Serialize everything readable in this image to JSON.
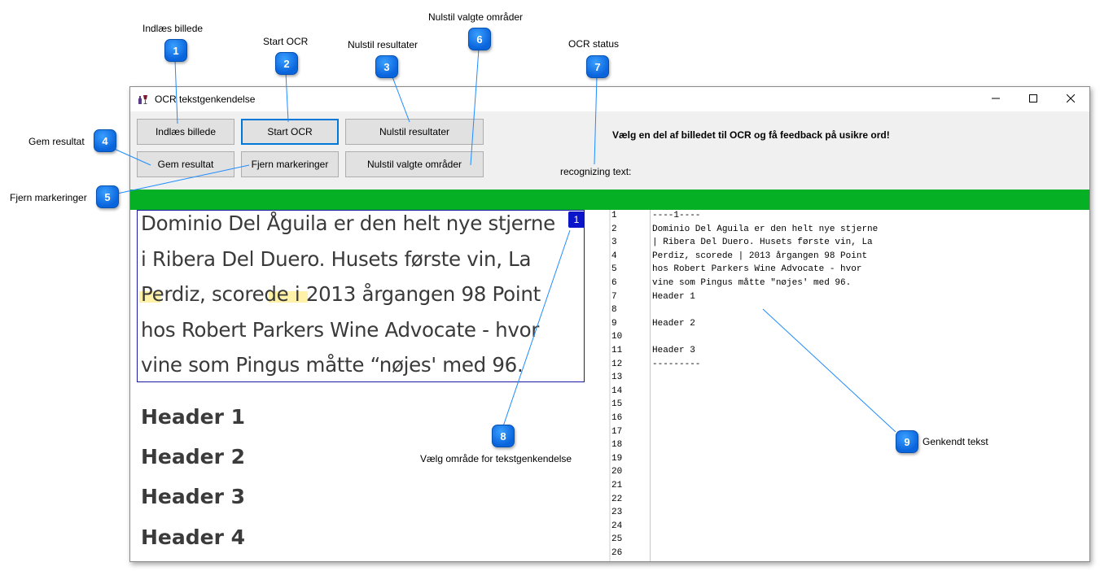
{
  "window": {
    "title": "OCR tekstgenkendelse"
  },
  "toolbar": {
    "load_image": "Indlæs billede",
    "start_ocr": "Start OCR",
    "reset_results": "Nulstil resultater",
    "save_result": "Gem resultat",
    "remove_marks": "Fjern markeringer",
    "reset_selected": "Nulstil valgte områder",
    "heading": "Vælg en del af billedet til OCR og få feedback på usikre ord!",
    "status": "recognizing text:"
  },
  "progress": {
    "value": 1.0,
    "color": "#06b025"
  },
  "image_pane": {
    "selection_tag": "1",
    "paragraph": [
      "Dominio Del Åguila er den helt nye stjerne",
      "i Ribera Del Duero. Husets første vin, La",
      "Perdiz, scorede i 2013 årgangen 98 Point",
      "hos Robert Parkers Wine Advocate - hvor",
      "vine som Pingus måtte “nøjes' med  96."
    ],
    "headers": [
      "Header 1",
      "Header 2",
      "Header 3",
      "Header 4"
    ]
  },
  "text_pane": {
    "line_numbers": [
      "1",
      "2",
      "3",
      "4",
      "5",
      "6",
      "7",
      "8",
      "9",
      "10",
      "11",
      "12",
      "13",
      "14",
      "15",
      "16",
      "17",
      "18",
      "19",
      "20",
      "21",
      "22",
      "23",
      "24",
      "25",
      "26"
    ],
    "lines": [
      "----1----",
      "Dominio Del Aguila er den helt nye stjerne",
      "| Ribera Del Duero. Husets første vin, La",
      "Perdiz, scorede | 2013 årgangen 98 Point",
      "hos Robert Parkers Wine Advocate - hvor",
      "vine som Pingus måtte \"nøjes' med 96.",
      "Header 1",
      "",
      "Header 2",
      "",
      "Header 3",
      "---------"
    ]
  },
  "callouts": [
    {
      "num": "1",
      "label": "Indlæs billede"
    },
    {
      "num": "2",
      "label": "Start OCR"
    },
    {
      "num": "3",
      "label": "Nulstil resultater"
    },
    {
      "num": "4",
      "label": "Gem resultat"
    },
    {
      "num": "5",
      "label": "Fjern markeringer"
    },
    {
      "num": "6",
      "label": "Nulstil valgte områder"
    },
    {
      "num": "7",
      "label": "OCR status"
    },
    {
      "num": "8",
      "label": "Vælg område for tekstgenkendelse"
    },
    {
      "num": "9",
      "label": "Genkendt tekst"
    }
  ],
  "colors": {
    "progress_green": "#06b025",
    "badge_blue": "#0a64dc",
    "selection_blue": "#1a1aa8",
    "leader_line": "#1e8cff",
    "highlight_yellow": "#ffe13c",
    "focus_blue": "#0078d7"
  },
  "icons": {
    "app": "wine-bottle-icon",
    "minimize": "minimize-icon",
    "maximize": "maximize-icon",
    "close": "close-icon"
  }
}
